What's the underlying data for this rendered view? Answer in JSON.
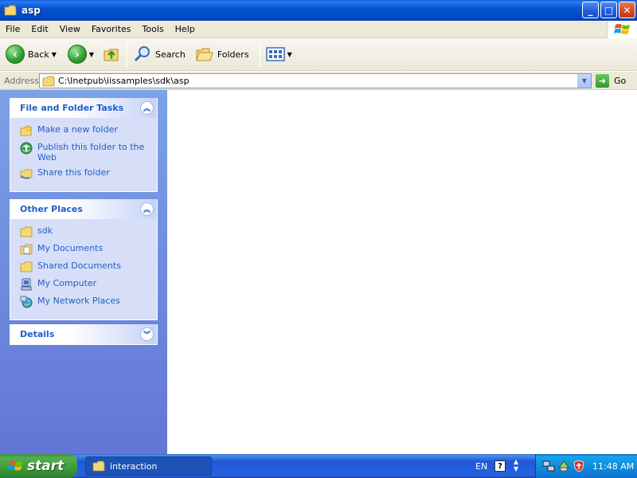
{
  "window": {
    "title": "asp",
    "buttons": {
      "minimize": "_",
      "maximize": "□",
      "close": "✕"
    }
  },
  "menu": {
    "items": [
      "File",
      "Edit",
      "View",
      "Favorites",
      "Tools",
      "Help"
    ]
  },
  "toolbar": {
    "back_label": "Back",
    "search_label": "Search",
    "folders_label": "Folders"
  },
  "address": {
    "label": "Address",
    "value": "C:\\Inetpub\\iissamples\\sdk\\asp",
    "go_label": "Go"
  },
  "panels": {
    "tasks": {
      "title": "File and Folder Tasks",
      "items": [
        {
          "label": "Make a new folder",
          "icon": "new-folder-icon"
        },
        {
          "label": "Publish this folder to the Web",
          "icon": "publish-web-icon"
        },
        {
          "label": "Share this folder",
          "icon": "share-folder-icon"
        }
      ]
    },
    "places": {
      "title": "Other Places",
      "items": [
        {
          "label": "sdk",
          "icon": "folder-icon"
        },
        {
          "label": "My Documents",
          "icon": "my-documents-icon"
        },
        {
          "label": "Shared Documents",
          "icon": "folder-icon"
        },
        {
          "label": "My Computer",
          "icon": "my-computer-icon"
        },
        {
          "label": "My Network Places",
          "icon": "network-places-icon"
        }
      ]
    },
    "details": {
      "title": "Details"
    }
  },
  "taskbar": {
    "start_label": "start",
    "task_button_label": "interaction",
    "language": "EN",
    "help": "?",
    "clock": "11:48 AM"
  },
  "colors": {
    "titlebar": "#0553d0",
    "panel_link": "#215dc6",
    "left_pane": "#7ba2e7",
    "start_button": "#3d9c3c"
  }
}
